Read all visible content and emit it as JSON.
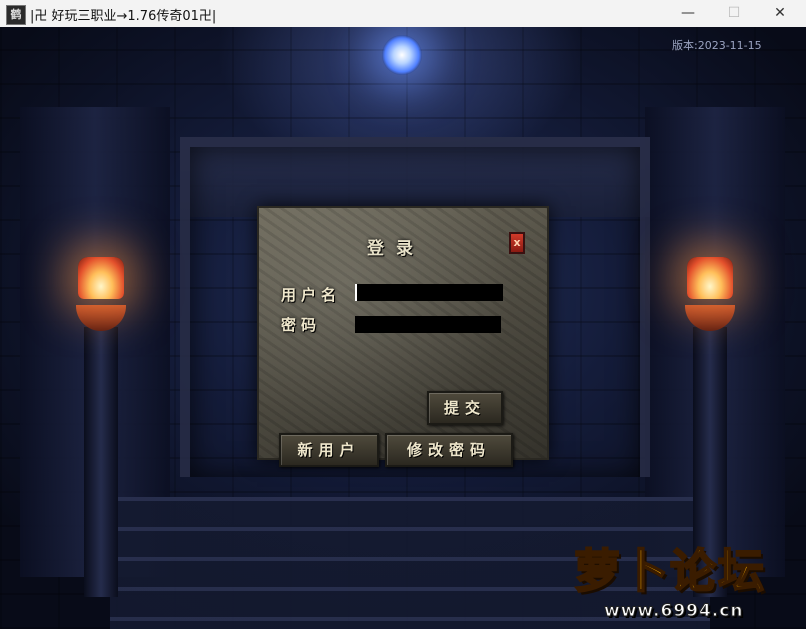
{
  "window": {
    "icon_text": "鹤",
    "title": "|卍 好玩三职业→1.76传奇01卍|",
    "minimize": "—",
    "maximize": "☐",
    "close": "✕"
  },
  "version_text": "版本:2023-11-15",
  "login": {
    "title": "登录",
    "close_glyph": "x",
    "username_label": "用户名",
    "password_label": "密码",
    "username_value": "",
    "password_value": "",
    "submit_label": "提交",
    "new_user_label": "新用户",
    "change_password_label": "修改密码"
  },
  "watermark": {
    "text": "萝卜论坛",
    "url": "www.6994.cn"
  }
}
